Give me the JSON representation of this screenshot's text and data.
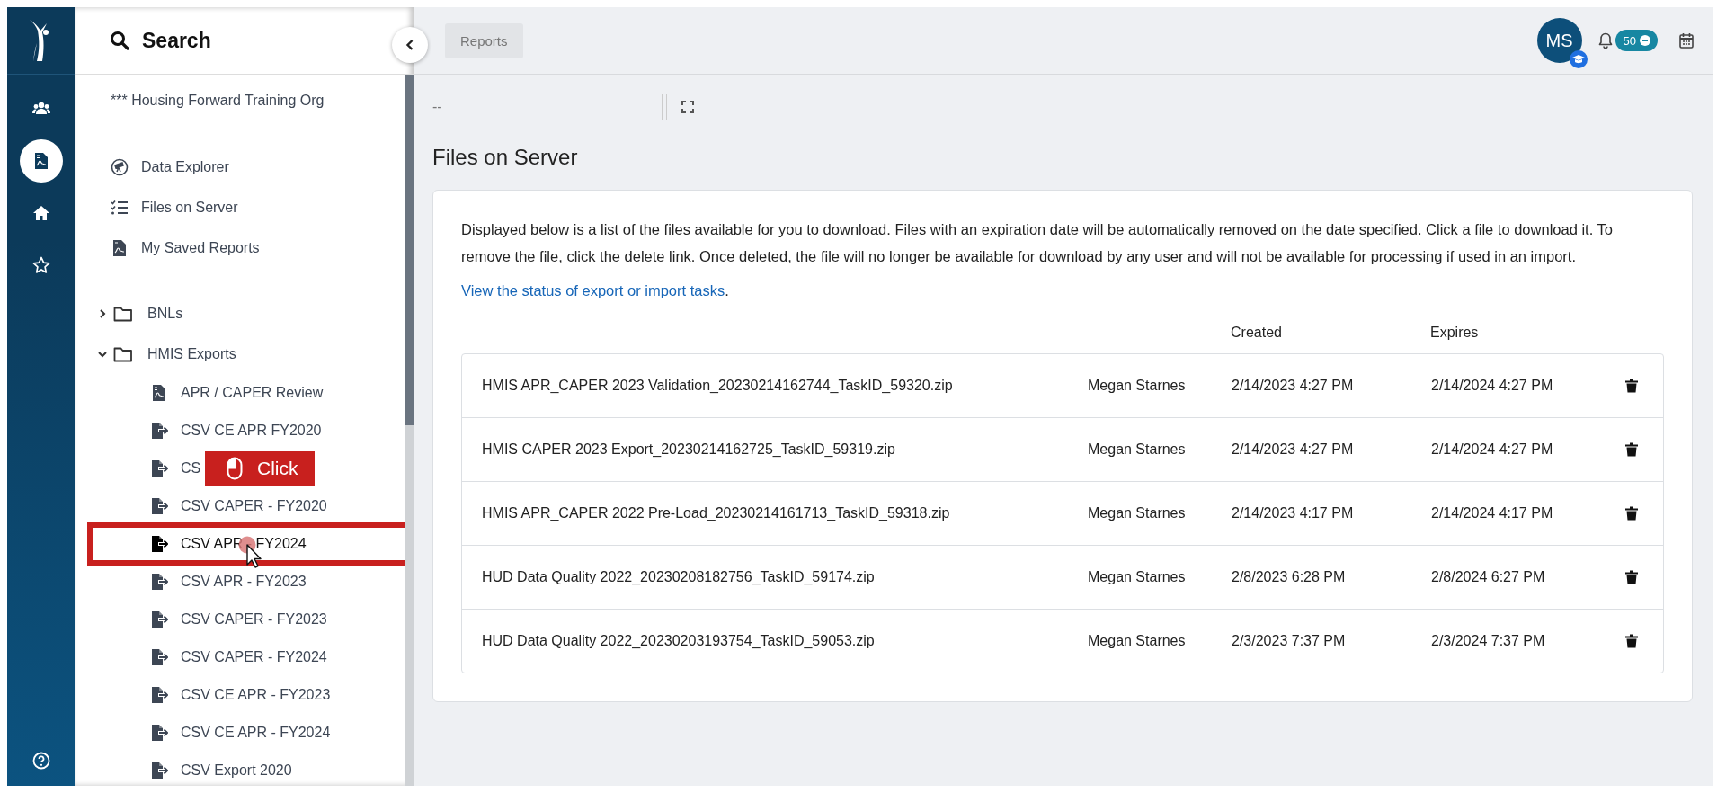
{
  "rail": {
    "items": [
      {
        "kind": "people",
        "selected": false
      },
      {
        "kind": "report",
        "selected": true
      },
      {
        "kind": "home",
        "selected": false
      },
      {
        "kind": "star",
        "selected": false
      }
    ]
  },
  "sidebar": {
    "title": "Search",
    "org": "*** Housing Forward Training Org",
    "links": [
      {
        "kind": "explorer",
        "label": "Data Explorer"
      },
      {
        "kind": "list",
        "label": "Files on Server"
      },
      {
        "kind": "report",
        "label": "My Saved Reports"
      }
    ],
    "tree": [
      {
        "label": "BNLs",
        "expanded": false
      },
      {
        "label": "HMIS Exports",
        "expanded": true,
        "children": [
          {
            "kind": "report",
            "label": "APR / CAPER Review",
            "highlighted": false
          },
          {
            "kind": "export",
            "label": "CSV CE APR FY2020",
            "highlighted": false
          },
          {
            "kind": "export",
            "label": "CS",
            "highlighted": false
          },
          {
            "kind": "export",
            "label": "CSV CAPER - FY2020",
            "highlighted": false
          },
          {
            "kind": "export",
            "label": "CSV APR - FY2024",
            "highlighted": true
          },
          {
            "kind": "export",
            "label": "CSV APR - FY2023",
            "highlighted": false
          },
          {
            "kind": "export",
            "label": "CSV CAPER - FY2023",
            "highlighted": false
          },
          {
            "kind": "export",
            "label": "CSV CAPER - FY2024",
            "highlighted": false
          },
          {
            "kind": "export",
            "label": "CSV CE APR - FY2023",
            "highlighted": false
          },
          {
            "kind": "export",
            "label": "CSV CE APR - FY2024",
            "highlighted": false
          },
          {
            "kind": "export",
            "label": "CSV Export 2020",
            "highlighted": false
          }
        ]
      }
    ]
  },
  "tutorial": {
    "label": "Click"
  },
  "breadcrumb": "Reports",
  "user": {
    "initials": "MS"
  },
  "notifications": {
    "count": "50"
  },
  "toolbar": {
    "value": "--"
  },
  "page_title": "Files on Server",
  "description": "Displayed below is a list of the files available for you to download. Files with an expiration date will be automatically removed on the date specified. Click a file to download it. To remove the file, click the delete link. Once deleted, the file will no longer be available for download by any user and will not be available for processing if used in an import.",
  "status_link": {
    "text": "View the status of export or import tasks",
    "suffix": "."
  },
  "files": {
    "columns": [
      "Created",
      "Expires"
    ],
    "rows": [
      {
        "name": "HMIS APR_CAPER 2023 Validation_20230214162744_TaskID_59320.zip",
        "owner": "Megan Starnes",
        "created": "2/14/2023 4:27 PM",
        "expires": "2/14/2024 4:27 PM"
      },
      {
        "name": "HMIS CAPER 2023 Export_20230214162725_TaskID_59319.zip",
        "owner": "Megan Starnes",
        "created": "2/14/2023 4:27 PM",
        "expires": "2/14/2024 4:27 PM"
      },
      {
        "name": "HMIS APR_CAPER 2022 Pre-Load_20230214161713_TaskID_59318.zip",
        "owner": "Megan Starnes",
        "created": "2/14/2023 4:17 PM",
        "expires": "2/14/2024 4:17 PM"
      },
      {
        "name": "HUD Data Quality 2022_20230208182756_TaskID_59174.zip",
        "owner": "Megan Starnes",
        "created": "2/8/2023 6:28 PM",
        "expires": "2/8/2024 6:27 PM"
      },
      {
        "name": "HUD Data Quality 2022_20230203193754_TaskID_59053.zip",
        "owner": "Megan Starnes",
        "created": "2/3/2023 7:37 PM",
        "expires": "2/3/2024 7:37 PM"
      }
    ]
  }
}
